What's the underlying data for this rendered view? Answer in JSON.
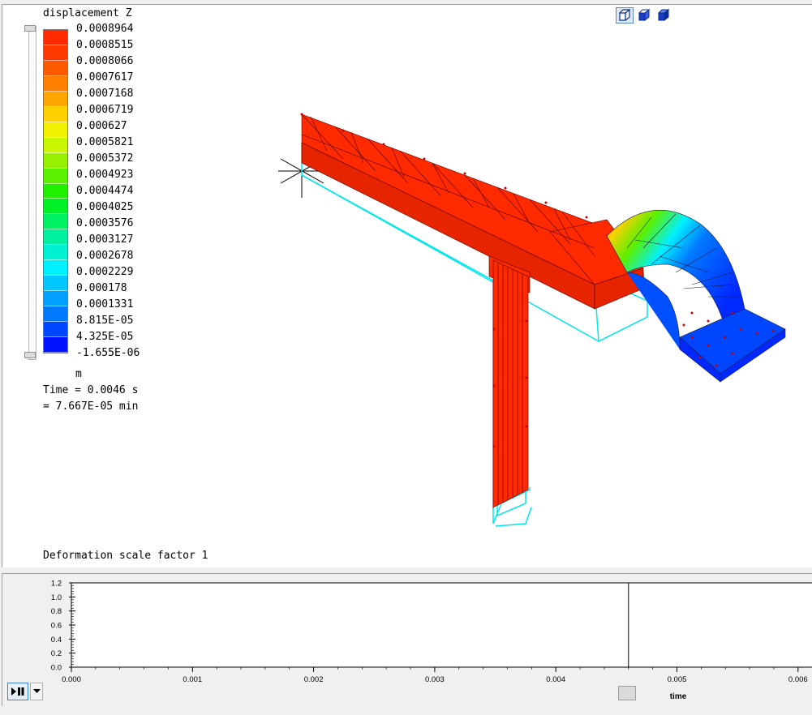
{
  "legend": {
    "title": "displacement Z",
    "unit": "m",
    "entries": [
      {
        "label": "0.0008964",
        "color": "#ff2a00"
      },
      {
        "label": "0.0008515",
        "color": "#ff3a00"
      },
      {
        "label": "0.0008066",
        "color": "#ff5a00"
      },
      {
        "label": "0.0007617",
        "color": "#ff7f00"
      },
      {
        "label": "0.0007168",
        "color": "#ffa500"
      },
      {
        "label": "0.0006719",
        "color": "#ffd000"
      },
      {
        "label": "0.000627",
        "color": "#f0f000"
      },
      {
        "label": "0.0005821",
        "color": "#c8f500"
      },
      {
        "label": "0.0005372",
        "color": "#96f000"
      },
      {
        "label": "0.0004923",
        "color": "#5af000"
      },
      {
        "label": "0.0004474",
        "color": "#1ef000"
      },
      {
        "label": "0.0004025",
        "color": "#00f028"
      },
      {
        "label": "0.0003576",
        "color": "#00f064"
      },
      {
        "label": "0.0003127",
        "color": "#00f0a0"
      },
      {
        "label": "0.0002678",
        "color": "#00f0d2"
      },
      {
        "label": "0.0002229",
        "color": "#00f0ff"
      },
      {
        "label": "0.000178",
        "color": "#00c8ff"
      },
      {
        "label": "0.0001331",
        "color": "#00a0ff"
      },
      {
        "label": "8.815E-05",
        "color": "#0078ff"
      },
      {
        "label": "4.325E-05",
        "color": "#0046ff"
      },
      {
        "label": "-1.655E-06",
        "color": "#0014ff"
      }
    ]
  },
  "time": {
    "line1": "Time = 0.0046 s",
    "line2": "= 7.667E-05 min"
  },
  "deformation": "Deformation scale factor 1",
  "view_buttons": [
    {
      "icon": "wireframe-cube-icon"
    },
    {
      "icon": "hidden-line-cube-icon"
    },
    {
      "icon": "solid-cube-icon"
    }
  ],
  "timeline": {
    "y_ticks": [
      "1.2",
      "1.0",
      "0.8",
      "0.6",
      "0.4",
      "0.2",
      "0.0"
    ],
    "x_ticks": [
      "0.000",
      "0.001",
      "0.002",
      "0.003",
      "0.004",
      "0.005",
      "0.006"
    ],
    "x_label": "time",
    "current_time": 0.0046,
    "play_icon": "play-pause-icon",
    "dropdown_icon": "chevron-down-icon"
  }
}
